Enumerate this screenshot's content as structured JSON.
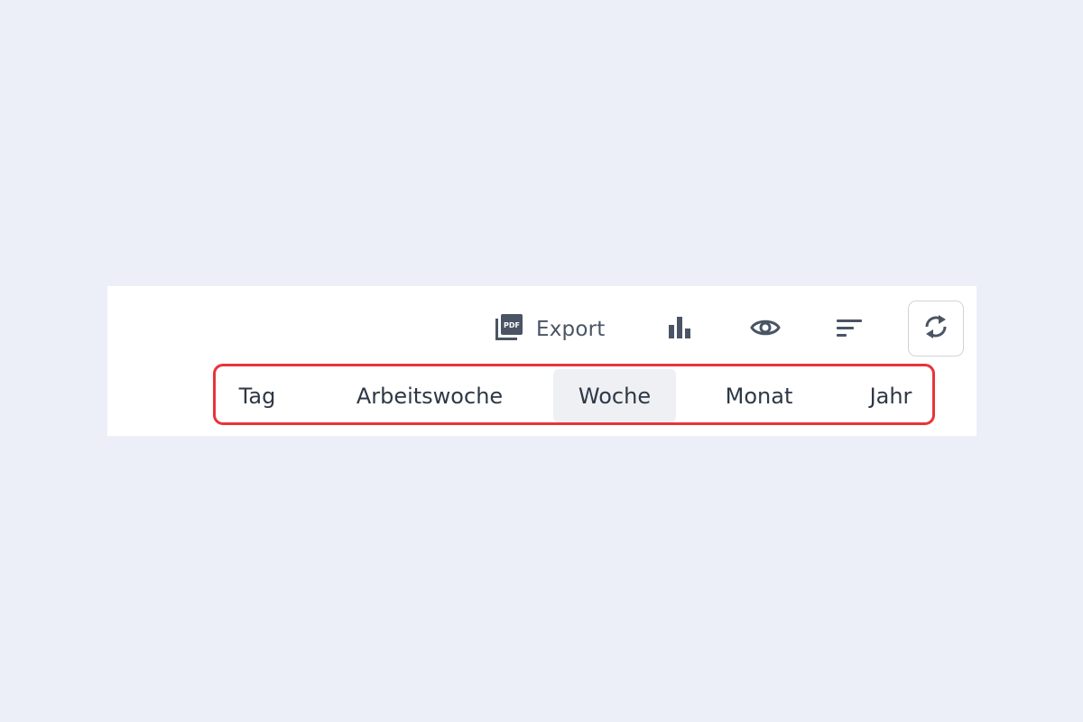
{
  "toolbar": {
    "export": {
      "icon": "pdf-icon",
      "label": "Export"
    },
    "chart": {
      "icon": "bar-chart-icon"
    },
    "view": {
      "icon": "eye-icon"
    },
    "sort": {
      "icon": "sort-icon"
    },
    "refresh": {
      "icon": "refresh-icon"
    }
  },
  "period_selector": {
    "options": [
      {
        "label": "Tag",
        "active": false
      },
      {
        "label": "Arbeitswoche",
        "active": false
      },
      {
        "label": "Woche",
        "active": true
      },
      {
        "label": "Monat",
        "active": false
      },
      {
        "label": "Jahr",
        "active": false
      }
    ]
  },
  "colors": {
    "background": "#eceff7",
    "panel": "#ffffff",
    "icon": "#4a5464",
    "text": "#2e3846",
    "highlight_border": "#e8343a",
    "active_bg": "#eff0f3"
  }
}
